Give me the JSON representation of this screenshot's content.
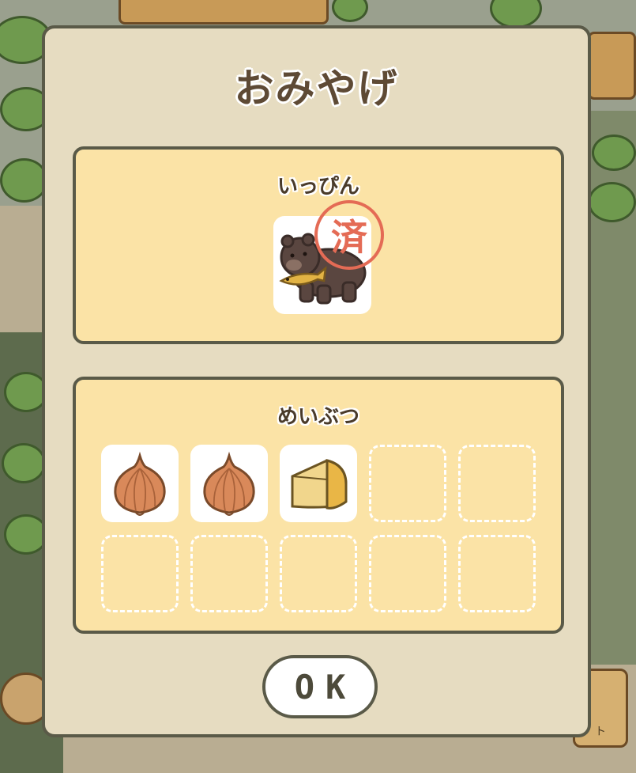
{
  "dialog": {
    "title": "おみやげ",
    "special_item": {
      "label": "いっぴん",
      "stamp_text": "済",
      "item_icon": "bear-with-fish-icon"
    },
    "regional_items": {
      "label": "めいぶつ",
      "slots": [
        {
          "icon": "onion-icon",
          "filled": true
        },
        {
          "icon": "onion-icon",
          "filled": true
        },
        {
          "icon": "cheese-icon",
          "filled": true
        },
        {
          "icon": "empty-slot",
          "filled": false
        },
        {
          "icon": "empty-slot",
          "filled": false
        },
        {
          "icon": "empty-slot",
          "filled": false
        },
        {
          "icon": "empty-slot",
          "filled": false
        },
        {
          "icon": "empty-slot",
          "filled": false
        },
        {
          "icon": "empty-slot",
          "filled": false
        },
        {
          "icon": "empty-slot",
          "filled": false
        }
      ]
    },
    "ok_label": "OK"
  },
  "background": {
    "hint_label": "ト"
  },
  "colors": {
    "panel_fill": "#fbe3a6",
    "dialog_fill": "#e6dcc1",
    "stamp_red": "#e46b55",
    "border": "#5a5a48"
  }
}
